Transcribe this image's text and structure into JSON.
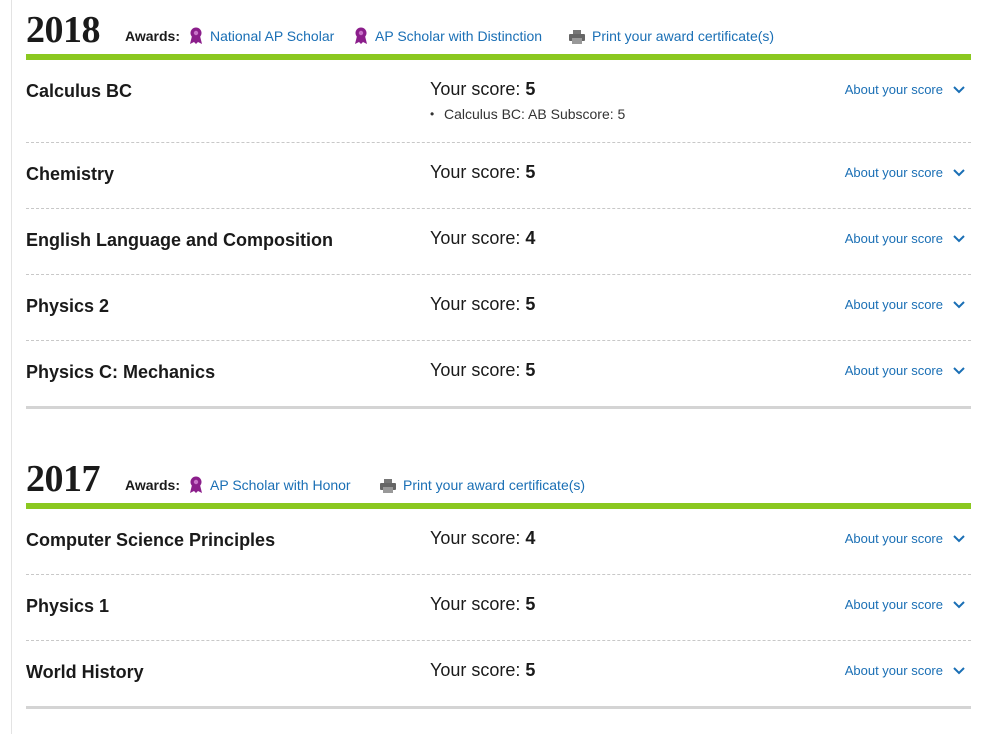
{
  "years": [
    {
      "year": "2018",
      "awards_label": "Awards:",
      "awards": [
        "National AP Scholar",
        "AP Scholar with Distinction"
      ],
      "print_label": "Print your award certificate(s)",
      "exams": [
        {
          "subject": "Calculus BC",
          "score_label": "Your score:",
          "score": "5",
          "subscore": "Calculus BC: AB Subscore: 5",
          "about": "About your score"
        },
        {
          "subject": "Chemistry",
          "score_label": "Your score:",
          "score": "5",
          "about": "About your score"
        },
        {
          "subject": "English Language and Composition",
          "score_label": "Your score:",
          "score": "4",
          "about": "About your score"
        },
        {
          "subject": "Physics 2",
          "score_label": "Your score:",
          "score": "5",
          "about": "About your score"
        },
        {
          "subject": "Physics C: Mechanics",
          "score_label": "Your score:",
          "score": "5",
          "about": "About your score"
        }
      ]
    },
    {
      "year": "2017",
      "awards_label": "Awards:",
      "awards": [
        "AP Scholar with Honor"
      ],
      "print_label": "Print your award certificate(s)",
      "exams": [
        {
          "subject": "Computer Science Principles",
          "score_label": "Your score:",
          "score": "4",
          "about": "About your score"
        },
        {
          "subject": "Physics 1",
          "score_label": "Your score:",
          "score": "5",
          "about": "About your score"
        },
        {
          "subject": "World History",
          "score_label": "Your score:",
          "score": "5",
          "about": "About your score"
        }
      ]
    }
  ],
  "colors": {
    "accent_bar": "#8bc820",
    "link": "#1a6fb5",
    "ribbon": "#8b1e8b"
  },
  "icons": {
    "award": "award-ribbon-icon",
    "print": "printer-icon",
    "expand": "chevron-down-icon"
  }
}
